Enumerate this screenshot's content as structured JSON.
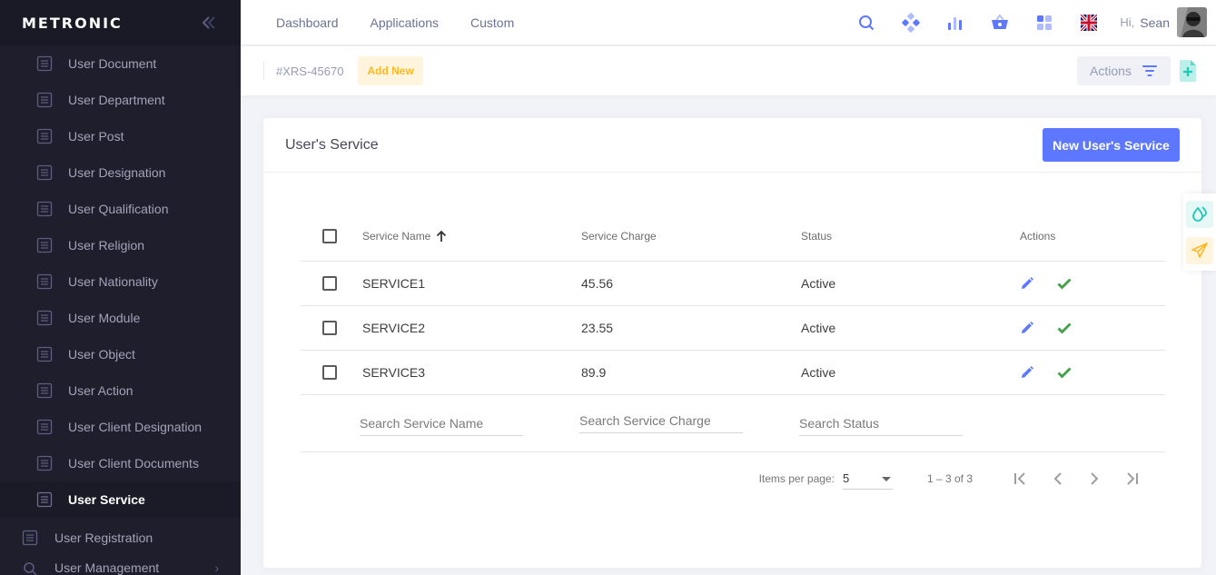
{
  "brand": {
    "logo": "METRONIC"
  },
  "sidebar": {
    "items": [
      {
        "label": "User Document"
      },
      {
        "label": "User Department"
      },
      {
        "label": "User Post"
      },
      {
        "label": "User Designation"
      },
      {
        "label": "User Qualification"
      },
      {
        "label": "User Religion"
      },
      {
        "label": "User Nationality"
      },
      {
        "label": "User Module"
      },
      {
        "label": "User Object"
      },
      {
        "label": "User Action"
      },
      {
        "label": "User Client Designation"
      },
      {
        "label": "User Client Documents"
      },
      {
        "label": "User Service",
        "active": true
      }
    ],
    "top_items": [
      {
        "label": "User Registration"
      },
      {
        "label": "User Management"
      }
    ]
  },
  "header": {
    "nav": [
      "Dashboard",
      "Applications",
      "Custom"
    ],
    "icons": [
      "search-icon",
      "layers-icon",
      "bar-chart-icon",
      "basket-icon",
      "apps-icon",
      "uk-flag-icon"
    ],
    "greeting": "Hi,",
    "user_name": "Sean"
  },
  "subheader": {
    "code": "#XRS-45670",
    "add_new": "Add New",
    "actions": "Actions"
  },
  "card": {
    "title": "User's Service",
    "new_button": "New User's Service"
  },
  "table": {
    "columns": [
      "Service Name",
      "Service Charge",
      "Status",
      "Actions"
    ],
    "rows": [
      {
        "name": "SERVICE1",
        "charge": "45.56",
        "status": "Active"
      },
      {
        "name": "SERVICE2",
        "charge": "23.55",
        "status": "Active"
      },
      {
        "name": "SERVICE3",
        "charge": "89.9",
        "status": "Active"
      }
    ],
    "filters": {
      "name_placeholder": "Search Service Name",
      "charge_placeholder": "Search Service Charge",
      "status_placeholder": "Search Status"
    }
  },
  "paginator": {
    "label": "Items per page:",
    "page_size": "5",
    "range": "1 – 3 of 3"
  },
  "colors": {
    "sidebar_bg": "#1e1e2d",
    "primary": "#5d78ff",
    "warning": "#ffb822",
    "success": "#34bfa3",
    "check": "#43a047"
  }
}
